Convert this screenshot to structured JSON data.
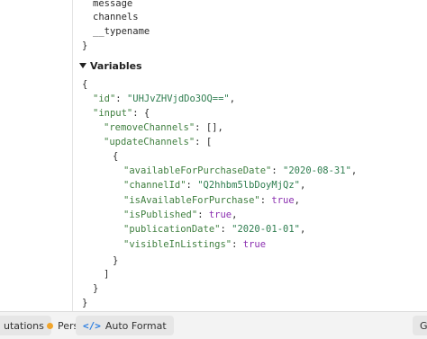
{
  "query_tail": {
    "fields": [
      "message",
      "channels",
      "__typename"
    ],
    "close_brace": "}"
  },
  "variables_section": {
    "title": "Variables"
  },
  "variables_code": {
    "open": "{",
    "id_key": "\"id\"",
    "id_value": "\"UHJvZHVjdDo3OQ==\"",
    "input_key": "\"input\"",
    "remove_key": "\"removeChannels\"",
    "remove_value": "[]",
    "update_key": "\"updateChannels\"",
    "update_open": "[",
    "obj_open": "{",
    "entries": [
      {
        "key": "\"availableForPurchaseDate\"",
        "value": "\"2020-08-31\"",
        "type": "str"
      },
      {
        "key": "\"channelId\"",
        "value": "\"Q2hhbm5lbDoyMjQz\"",
        "type": "str"
      },
      {
        "key": "\"isAvailableForPurchase\"",
        "value": "true",
        "type": "kw"
      },
      {
        "key": "\"isPublished\"",
        "value": "true",
        "type": "kw"
      },
      {
        "key": "\"publicationDate\"",
        "value": "\"2020-01-01\"",
        "type": "str"
      },
      {
        "key": "\"visibleInListings\"",
        "value": "true",
        "type": "kw"
      }
    ],
    "obj_close": "}",
    "update_close": "]",
    "input_close": "}",
    "close": "}"
  },
  "bottom_bar": {
    "mutations_label": "utations",
    "persisted_label": "Pers",
    "auto_format_label": "Auto Format",
    "right_label": "Ge"
  }
}
